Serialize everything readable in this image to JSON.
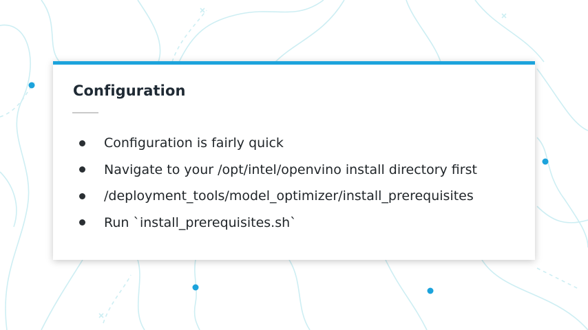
{
  "slide": {
    "title": "Configuration",
    "bullets": [
      "Configuration is fairly quick",
      "Navigate to your /opt/intel/openvino install directory first",
      "/deployment_tools/model_optimizer/install_prerequisites",
      "Run `install_prerequisites.sh`"
    ]
  },
  "colors": {
    "accent": "#1ca3dc",
    "background_lines": "#cdeef3",
    "title": "#1f2a34",
    "bullet_text": "#1f2428"
  }
}
